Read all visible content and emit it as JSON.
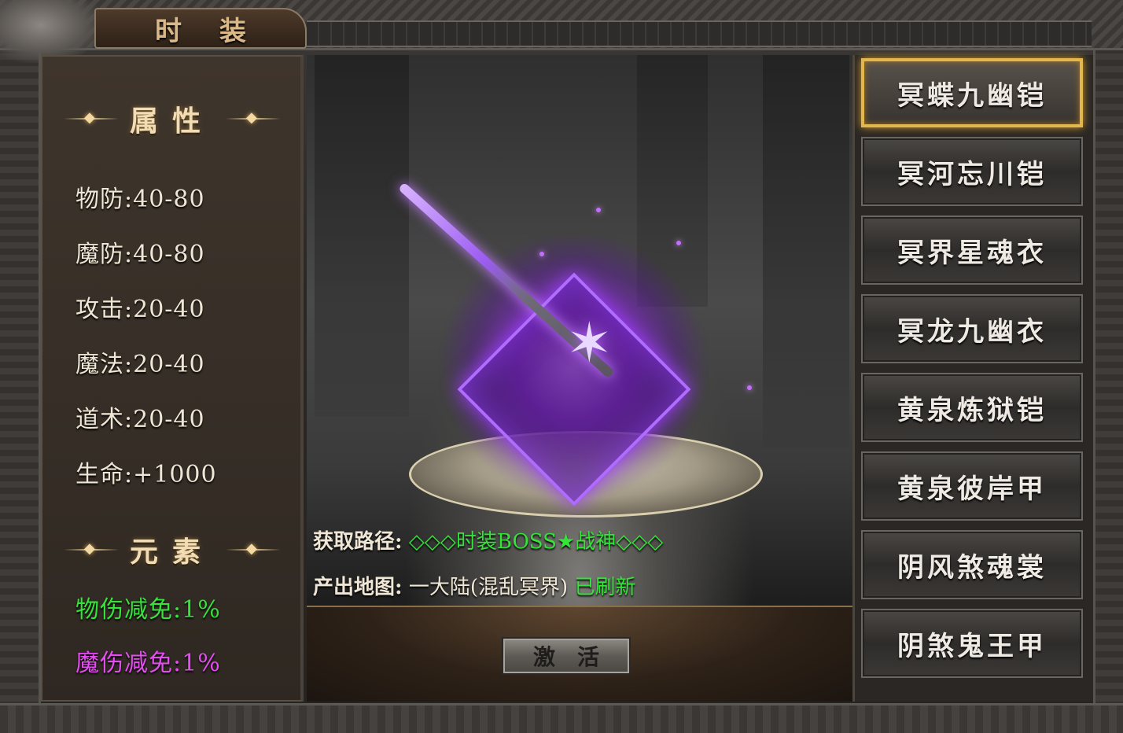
{
  "window": {
    "title": "时装"
  },
  "attributes": {
    "section_title": "属性",
    "stats": [
      "物防:40-80",
      "魔防:40-80",
      "攻击:20-40",
      "魔法:20-40",
      "道术:20-40",
      "生命:+1000"
    ]
  },
  "elements": {
    "section_title": "元素",
    "items": [
      {
        "text": "物伤减免:1%",
        "color": "#35e33a"
      },
      {
        "text": "魔伤减免:1%",
        "color": "#e54df2"
      }
    ]
  },
  "info": {
    "source_label": "获取路径:",
    "source_value": "◇◇◇时装BOSS★战神◇◇◇",
    "map_label": "产出地图:",
    "map_value": "一大陆(混乱冥界)",
    "map_status": "已刷新"
  },
  "actions": {
    "activate_label": "激活"
  },
  "costume_list": {
    "selected_index": 0,
    "items": [
      "冥蝶九幽铠",
      "冥河忘川铠",
      "冥界星魂衣",
      "冥龙九幽衣",
      "黄泉炼狱铠",
      "黄泉彼岸甲",
      "阴风煞魂裳",
      "阴煞鬼王甲"
    ]
  },
  "colors": {
    "accent_gold": "#e4b64e",
    "green": "#35e33a",
    "magenta": "#e54df2",
    "purple_glow": "#a040ff"
  }
}
